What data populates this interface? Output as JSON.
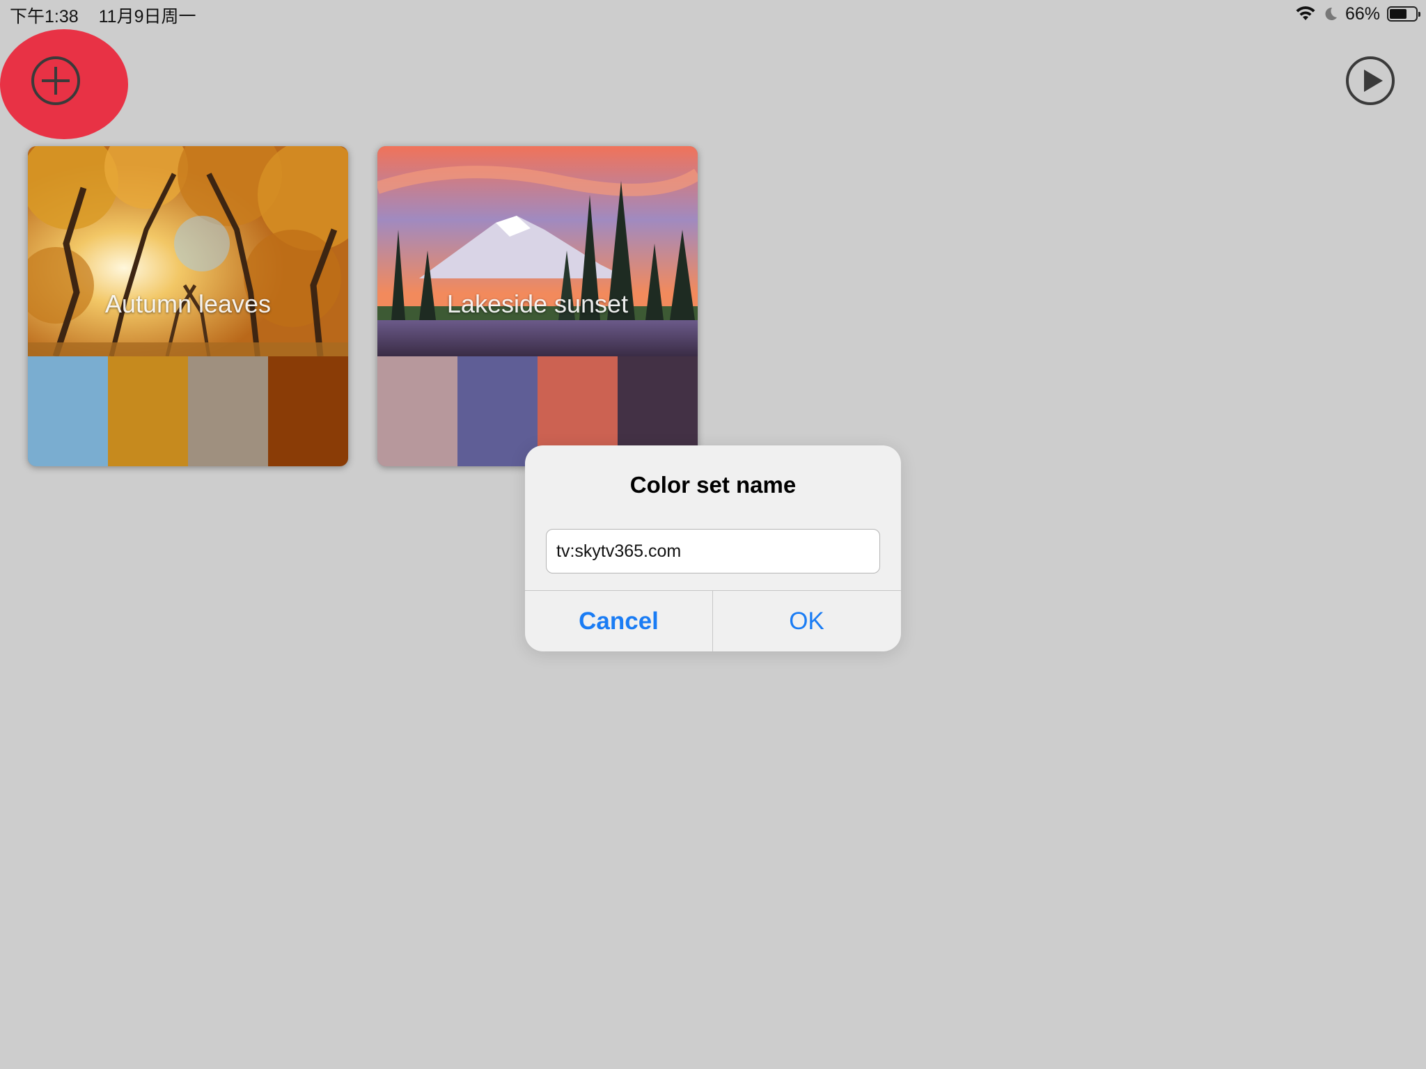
{
  "status_bar": {
    "time": "下午1:38",
    "date": "11月9日周一",
    "battery_text": "66%",
    "battery_level": 0.66,
    "icons": [
      "wifi-icon",
      "do-not-disturb-moon-icon",
      "battery-icon"
    ]
  },
  "toolbar": {
    "add_icon": "plus-circle-icon",
    "play_icon": "play-circle-icon",
    "highlight_color": "#e83245"
  },
  "color_sets": [
    {
      "name": "Autumn leaves",
      "swatches": [
        "#7aadd0",
        "#c68a1e",
        "#9f907f",
        "#8a3c06"
      ]
    },
    {
      "name": "Lakeside sunset",
      "swatches": [
        "#b7989c",
        "#5f5e96",
        "#cc6252",
        "#433145"
      ]
    }
  ],
  "dialog": {
    "title": "Color set name",
    "input_value": "tv:skytv365.com",
    "cancel_label": "Cancel",
    "ok_label": "OK",
    "button_color": "#1a7cf4"
  }
}
